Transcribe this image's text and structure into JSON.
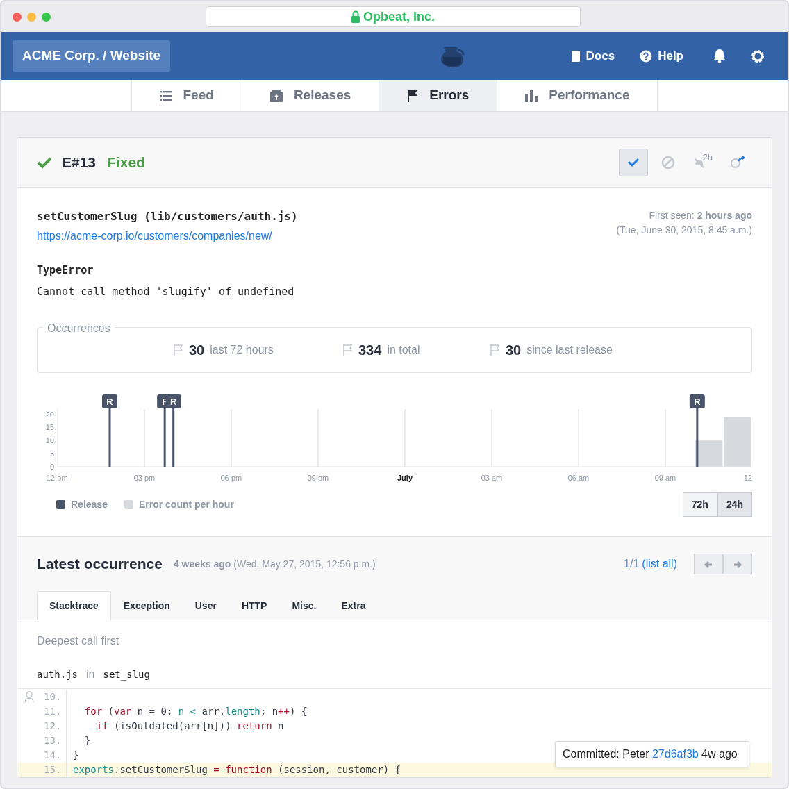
{
  "browser": {
    "address": "Opbeat, Inc.",
    "secure": true
  },
  "header": {
    "project": "ACME Corp. / Website",
    "links": [
      {
        "label": "Docs",
        "kind": "docs"
      },
      {
        "label": "Help",
        "kind": "help"
      }
    ]
  },
  "nav_tabs": [
    {
      "label": "Feed",
      "kind": "list",
      "selected": false
    },
    {
      "label": "Releases",
      "kind": "box",
      "selected": false
    },
    {
      "label": "Errors",
      "kind": "flag",
      "selected": true
    },
    {
      "label": "Performance",
      "kind": "bars",
      "selected": false
    }
  ],
  "error": {
    "fixed": true,
    "id": "E#13",
    "status": "Fixed",
    "actions": [
      {
        "kind": "resolve",
        "selected": true
      },
      {
        "kind": "ignore",
        "selected": false
      },
      {
        "kind": "snooze",
        "label": "2h",
        "selected": false
      },
      {
        "kind": "share",
        "selected": false
      }
    ],
    "culprit": "setCustomerSlug (lib/customers/auth.js)",
    "url": "https://acme-corp.io/customers/companies/new/",
    "first_seen": "First seen: **2 hours ago**",
    "first_seen_date": "(Tue, June 30, 2015, 8:45 a.m.)",
    "exception_type": "TypeError",
    "message": "Cannot call method 'slugify' of undefined"
  },
  "occurrences": {
    "title": "Occurrences",
    "stats": [
      {
        "value": "30",
        "label": "last 72 hours"
      },
      {
        "value": "334",
        "label": "in total"
      },
      {
        "value": "30",
        "label": "since last release"
      }
    ]
  },
  "chart": {
    "chart_data": {
      "type": "bar",
      "categories": [
        "12 pm",
        null,
        null,
        "03 pm",
        null,
        null,
        "06 pm",
        null,
        null,
        "09 pm",
        null,
        null,
        "July",
        null,
        null,
        "03 am",
        null,
        null,
        "06 am",
        null,
        null,
        "09 am",
        null,
        null,
        "12"
      ],
      "series": [
        {
          "name": "Error count per hour",
          "color": "#d6d9de",
          "values": [
            null,
            null,
            null,
            null,
            null,
            null,
            null,
            null,
            null,
            null,
            null,
            null,
            null,
            null,
            null,
            null,
            null,
            null,
            null,
            null,
            null,
            null,
            10,
            19,
            null
          ]
        }
      ],
      "ylim": [
        0,
        22
      ],
      "yticks": [
        0,
        5,
        10,
        15,
        20
      ],
      "grid": true,
      "annotations": [
        {
          "text": "R"
        },
        {
          "text": "F"
        },
        {
          "text": "R"
        },
        {
          "text": "R"
        }
      ]
    },
    "legend": [
      {
        "label": "Release",
        "color": "#4a5468"
      }
    ],
    "ranges": [
      {
        "label": "72h",
        "selected": false
      },
      {
        "label": "24h",
        "selected": true
      }
    ]
  },
  "latest": {
    "title": "Latest occurrence",
    "when": "**4 weeks ago** (Wed, May 27, 2015, 12:56 p.m.)",
    "pager": "1/1",
    "list_all": "(list all)",
    "tabs": [
      {
        "label": "Stacktrace",
        "selected": true
      },
      {
        "label": "Exception",
        "selected": false
      },
      {
        "label": "User",
        "selected": false
      },
      {
        "label": "HTTP",
        "selected": false
      },
      {
        "label": "Misc.",
        "selected": false
      },
      {
        "label": "Extra",
        "selected": false
      }
    ],
    "note": "Deepest call first",
    "frame_file": "auth.js",
    "frame_sep": "in",
    "frame_function": "set_slug",
    "code": [
      {
        "number": "10.",
        "highlighted": false
      },
      {
        "number": "11.",
        "highlighted": false,
        "tokens": [
          {
            "kind": "keyword",
            "text": "  for"
          },
          {
            "kind": "plain",
            "text": " ("
          },
          {
            "kind": "keyword",
            "text": "var"
          },
          {
            "kind": "plain",
            "text": " n = 0; "
          },
          {
            "kind": "builtin",
            "text": "n <"
          },
          {
            "kind": "plain",
            "text": " arr."
          },
          {
            "kind": "builtin",
            "text": "length"
          },
          {
            "kind": "plain",
            "text": "; n"
          },
          {
            "kind": "keyword",
            "text": "++"
          },
          {
            "kind": "plain",
            "text": ") {"
          }
        ]
      },
      {
        "number": "12.",
        "highlighted": false,
        "tokens": [
          {
            "kind": "keyword",
            "text": "    if"
          },
          {
            "kind": "plain",
            "text": " (isOutdated(arr[n])) "
          },
          {
            "kind": "keyword",
            "text": "return"
          },
          {
            "kind": "plain",
            "text": " n"
          }
        ]
      },
      {
        "number": "13.",
        "highlighted": false,
        "tokens": [
          {
            "kind": "plain",
            "text": "  }"
          }
        ]
      },
      {
        "number": "14.",
        "highlighted": false,
        "tokens": [
          {
            "kind": "plain",
            "text": "}"
          }
        ]
      },
      {
        "number": "15.",
        "highlighted": true,
        "tokens": [
          {
            "kind": "builtin",
            "text": "exports"
          },
          {
            "kind": "plain",
            "text": ".setCustomerSlug "
          },
          {
            "kind": "keyword",
            "text": "="
          },
          {
            "kind": "keyword",
            "text": " function"
          },
          {
            "kind": "plain",
            "text": " (session, customer) {"
          }
        ]
      }
    ],
    "tooltip": [
      {
        "label": "Committed: Peter",
        "link": "27d6af3b",
        "after": "4w ago"
      }
    ]
  }
}
